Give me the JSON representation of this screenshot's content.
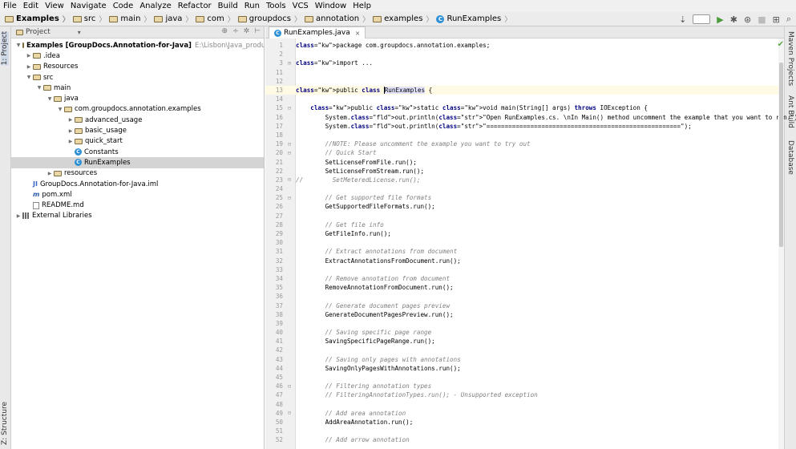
{
  "menu": [
    "File",
    "Edit",
    "View",
    "Navigate",
    "Code",
    "Analyze",
    "Refactor",
    "Build",
    "Run",
    "Tools",
    "VCS",
    "Window",
    "Help"
  ],
  "breadcrumbs": [
    "Examples",
    "src",
    "main",
    "java",
    "com",
    "groupdocs",
    "annotation",
    "examples",
    "RunExamples"
  ],
  "left_stripe": {
    "project": "1: Project",
    "structure": "Z: Structure"
  },
  "right_stripe": {
    "maven": "Maven Projects",
    "ant": "Ant Build",
    "database": "Database"
  },
  "project_panel": {
    "header": "Project",
    "tree": [
      {
        "depth": 0,
        "open": true,
        "icon": "folder",
        "label": "Examples [GroupDocs.Annotation-for-Java]",
        "extra": "E:\\Lisbon\\Java_products\\annotation",
        "bold": true
      },
      {
        "depth": 1,
        "open": false,
        "icon": "folder",
        "label": ".idea"
      },
      {
        "depth": 1,
        "open": false,
        "icon": "folder",
        "label": "Resources"
      },
      {
        "depth": 1,
        "open": true,
        "icon": "folder",
        "label": "src"
      },
      {
        "depth": 2,
        "open": true,
        "icon": "folder",
        "label": "main"
      },
      {
        "depth": 3,
        "open": true,
        "icon": "folder",
        "label": "java"
      },
      {
        "depth": 4,
        "open": true,
        "icon": "folder",
        "label": "com.groupdocs.annotation.examples"
      },
      {
        "depth": 5,
        "open": false,
        "icon": "folder",
        "label": "advanced_usage"
      },
      {
        "depth": 5,
        "open": false,
        "icon": "folder",
        "label": "basic_usage"
      },
      {
        "depth": 5,
        "open": false,
        "icon": "folder",
        "label": "quick_start"
      },
      {
        "depth": 5,
        "leaf": true,
        "icon": "class",
        "label": "Constants"
      },
      {
        "depth": 5,
        "leaf": true,
        "icon": "class",
        "label": "RunExamples",
        "selected": true
      },
      {
        "depth": 3,
        "open": false,
        "icon": "folder",
        "label": "resources"
      },
      {
        "depth": 1,
        "leaf": true,
        "icon": "iml",
        "label": "GroupDocs.Annotation-for-Java.iml"
      },
      {
        "depth": 1,
        "leaf": true,
        "icon": "maven",
        "label": "pom.xml"
      },
      {
        "depth": 1,
        "leaf": true,
        "icon": "file",
        "label": "README.md"
      },
      {
        "depth": 0,
        "open": false,
        "icon": "lib",
        "label": "External Libraries"
      }
    ]
  },
  "editor": {
    "tab": "RunExamples.java",
    "lines": [
      {
        "n": "1",
        "t": "package com.groupdocs.annotation.examples;"
      },
      {
        "n": "2",
        "t": ""
      },
      {
        "n": "3",
        "t": "import ...",
        "fold": "+"
      },
      {
        "n": "11",
        "t": ""
      },
      {
        "n": "12",
        "t": ""
      },
      {
        "n": "13",
        "t": "public class RunExamples {",
        "current": true
      },
      {
        "n": "14",
        "t": ""
      },
      {
        "n": "15",
        "t": "    public static void main(String[] args) throws IOException {",
        "fold": "-"
      },
      {
        "n": "16",
        "t": "        System.out.println(\"Open RunExamples.cs. \\nIn Main() method uncomment the example that you want to run.\");"
      },
      {
        "n": "17",
        "t": "        System.out.println(\"=====================================================\");"
      },
      {
        "n": "18",
        "t": ""
      },
      {
        "n": "19",
        "t": "        //NOTE: Please uncomment the example you want to try out",
        "fold": "-"
      },
      {
        "n": "20",
        "t": "        // Quick Start",
        "fold": "-"
      },
      {
        "n": "21",
        "t": "        SetLicenseFromFile.run();"
      },
      {
        "n": "22",
        "t": "        SetLicenseFromStream.run();"
      },
      {
        "n": "23",
        "t": "//        SetMeteredLicense.run();",
        "fold": "-"
      },
      {
        "n": "24",
        "t": ""
      },
      {
        "n": "25",
        "t": "        // Get supported file formats",
        "fold": "-"
      },
      {
        "n": "26",
        "t": "        GetSupportedFileFormats.run();"
      },
      {
        "n": "27",
        "t": ""
      },
      {
        "n": "28",
        "t": "        // Get file info"
      },
      {
        "n": "29",
        "t": "        GetFileInfo.run();"
      },
      {
        "n": "30",
        "t": ""
      },
      {
        "n": "31",
        "t": "        // Extract annotations from document"
      },
      {
        "n": "32",
        "t": "        ExtractAnnotationsFromDocument.run();"
      },
      {
        "n": "33",
        "t": ""
      },
      {
        "n": "34",
        "t": "        // Remove annotation from document"
      },
      {
        "n": "35",
        "t": "        RemoveAnnotationFromDocument.run();"
      },
      {
        "n": "36",
        "t": ""
      },
      {
        "n": "37",
        "t": "        // Generate document pages preview"
      },
      {
        "n": "38",
        "t": "        GenerateDocumentPagesPreview.run();"
      },
      {
        "n": "39",
        "t": ""
      },
      {
        "n": "40",
        "t": "        // Saving specific page range"
      },
      {
        "n": "41",
        "t": "        SavingSpecificPageRange.run();"
      },
      {
        "n": "42",
        "t": ""
      },
      {
        "n": "43",
        "t": "        // Saving only pages with annotations"
      },
      {
        "n": "44",
        "t": "        SavingOnlyPagesWithAnnotations.run();"
      },
      {
        "n": "45",
        "t": ""
      },
      {
        "n": "46",
        "t": "        // Filtering annotation types",
        "fold": "-"
      },
      {
        "n": "47",
        "t": "        // FilteringAnnotationTypes.run(); - Unsupported exception"
      },
      {
        "n": "48",
        "t": ""
      },
      {
        "n": "49",
        "t": "        // Add area annotation",
        "fold": "-"
      },
      {
        "n": "50",
        "t": "        AddAreaAnnotation.run();"
      },
      {
        "n": "51",
        "t": ""
      },
      {
        "n": "52",
        "t": "        // Add arrow annotation"
      }
    ]
  }
}
